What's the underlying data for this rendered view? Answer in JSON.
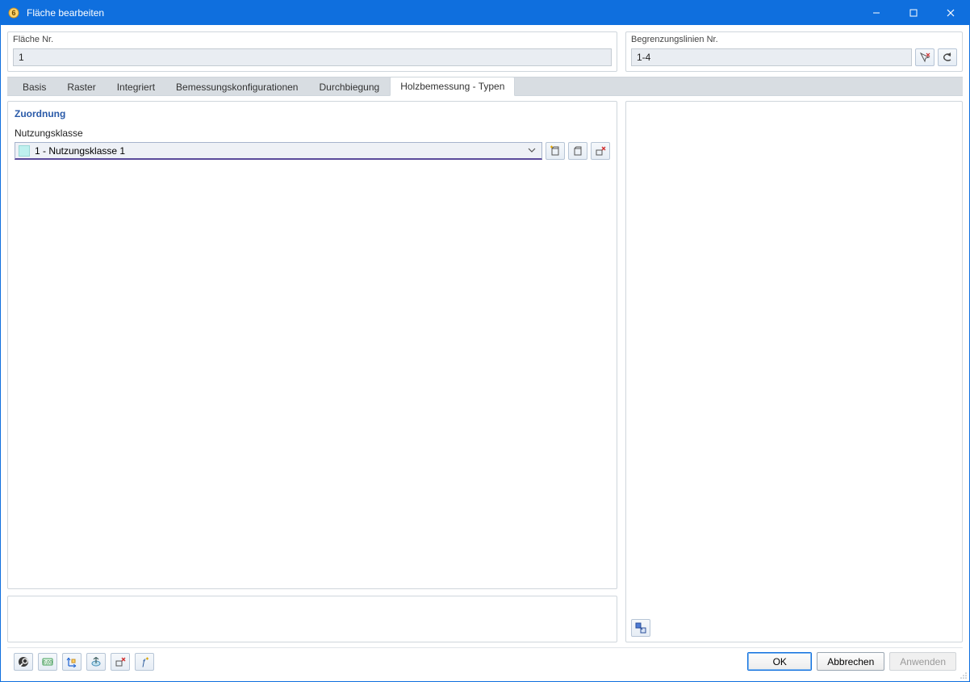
{
  "window": {
    "title": "Fläche bearbeiten"
  },
  "top": {
    "left_label": "Fläche Nr.",
    "left_value": "1",
    "right_label": "Begrenzungslinien Nr.",
    "right_value": "1-4"
  },
  "tabs": [
    {
      "label": "Basis",
      "active": false
    },
    {
      "label": "Raster",
      "active": false
    },
    {
      "label": "Integriert",
      "active": false
    },
    {
      "label": "Bemessungskonfigurationen",
      "active": false
    },
    {
      "label": "Durchbiegung",
      "active": false
    },
    {
      "label": "Holzbemessung - Typen",
      "active": true
    }
  ],
  "assignment": {
    "section_title": "Zuordnung",
    "field_label": "Nutzungsklasse",
    "combo_value": "1 - Nutzungsklasse 1"
  },
  "buttons": {
    "ok": "OK",
    "cancel": "Abbrechen",
    "apply": "Anwenden"
  }
}
